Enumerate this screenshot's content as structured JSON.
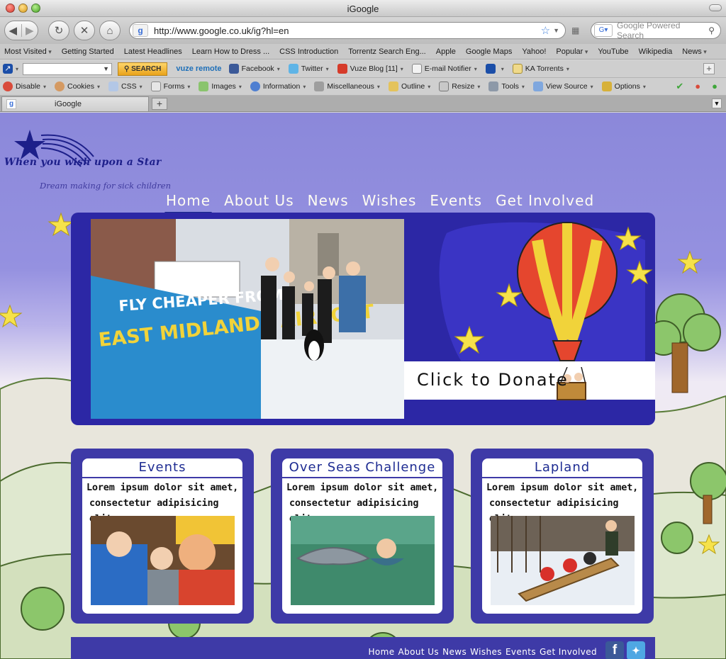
{
  "window": {
    "title": "iGoogle"
  },
  "navbar": {
    "url": "http://www.google.co.uk/ig?hl=en",
    "search_placeholder": "Google Powered Search",
    "search_engine_icon": "google-search-icon"
  },
  "bookmarks": [
    "Most Visited",
    "Getting Started",
    "Latest Headlines",
    "Learn How to Dress ...",
    "CSS Introduction",
    "Torrentz Search Eng...",
    "Apple",
    "Google Maps",
    "Yahoo!",
    "Popular",
    "YouTube",
    "Wikipedia",
    "News"
  ],
  "toolbar1": {
    "search_button": "SEARCH",
    "vuze": "vuze remote",
    "items": [
      "Facebook",
      "Twitter",
      "Vuze Blog [11]",
      "E-mail Notifier",
      "KA Torrents"
    ]
  },
  "toolbar2": {
    "items": [
      "Disable",
      "Cookies",
      "CSS",
      "Forms",
      "Images",
      "Information",
      "Miscellaneous",
      "Outline",
      "Resize",
      "Tools",
      "View Source",
      "Options"
    ]
  },
  "tabs": [
    {
      "title": "iGoogle"
    }
  ],
  "site": {
    "logo_title": "When you wish upon a Star",
    "logo_subtitle": "Dream making for sick children",
    "nav": [
      "Home",
      "About Us",
      "News",
      "Wishes",
      "Events",
      "Get Involved"
    ],
    "nav_active": "Home",
    "hero": {
      "banner_line1": "FLY CHEAPER FROM",
      "banner_line2": "EAST MIDLANDS AIRPORT",
      "donate": "Click to Donate"
    },
    "cards": [
      {
        "title": "Events",
        "line1": "Lorem ipsum dolor sit amet,",
        "line2": "consectetur adipisicing elit,"
      },
      {
        "title": "Over Seas Challenge",
        "line1": "Lorem ipsum dolor sit amet,",
        "line2": "consectetur adipisicing elit,"
      },
      {
        "title": "Lapland",
        "line1": "Lorem ipsum dolor sit amet,",
        "line2": "consectetur adipisicing elit,"
      }
    ],
    "footer_nav": [
      "Home",
      "About Us",
      "News",
      "Wishes",
      "Events",
      "Get Involved"
    ]
  },
  "colors": {
    "brand_purple": "#3e3aa7",
    "hero_blue": "#2c27a5",
    "nav_text": "#fffdf2",
    "card_title": "#1e2c92"
  }
}
